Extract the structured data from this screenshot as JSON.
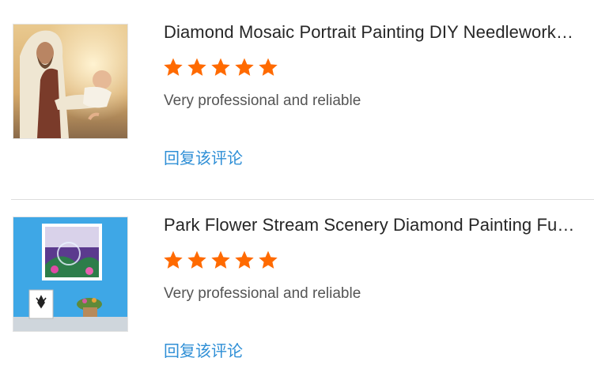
{
  "reviews": [
    {
      "product_title": "Diamond Mosaic Portrait Painting DIY Needlework Cross Stitch",
      "rating": 5,
      "rating_max": 5,
      "review_text": "Very professional and reliable",
      "reply_label": "回复该评论"
    },
    {
      "product_title": "Park Flower Stream Scenery Diamond Painting Full Drill",
      "rating": 5,
      "rating_max": 5,
      "review_text": "Very professional and reliable",
      "reply_label": "回复该评论"
    }
  ],
  "colors": {
    "star": "#ff6a00",
    "link": "#2f8fd6",
    "title": "#262626",
    "body_text": "#555555",
    "divider": "#dddddd"
  },
  "icons": {
    "rating": "star-icon"
  }
}
